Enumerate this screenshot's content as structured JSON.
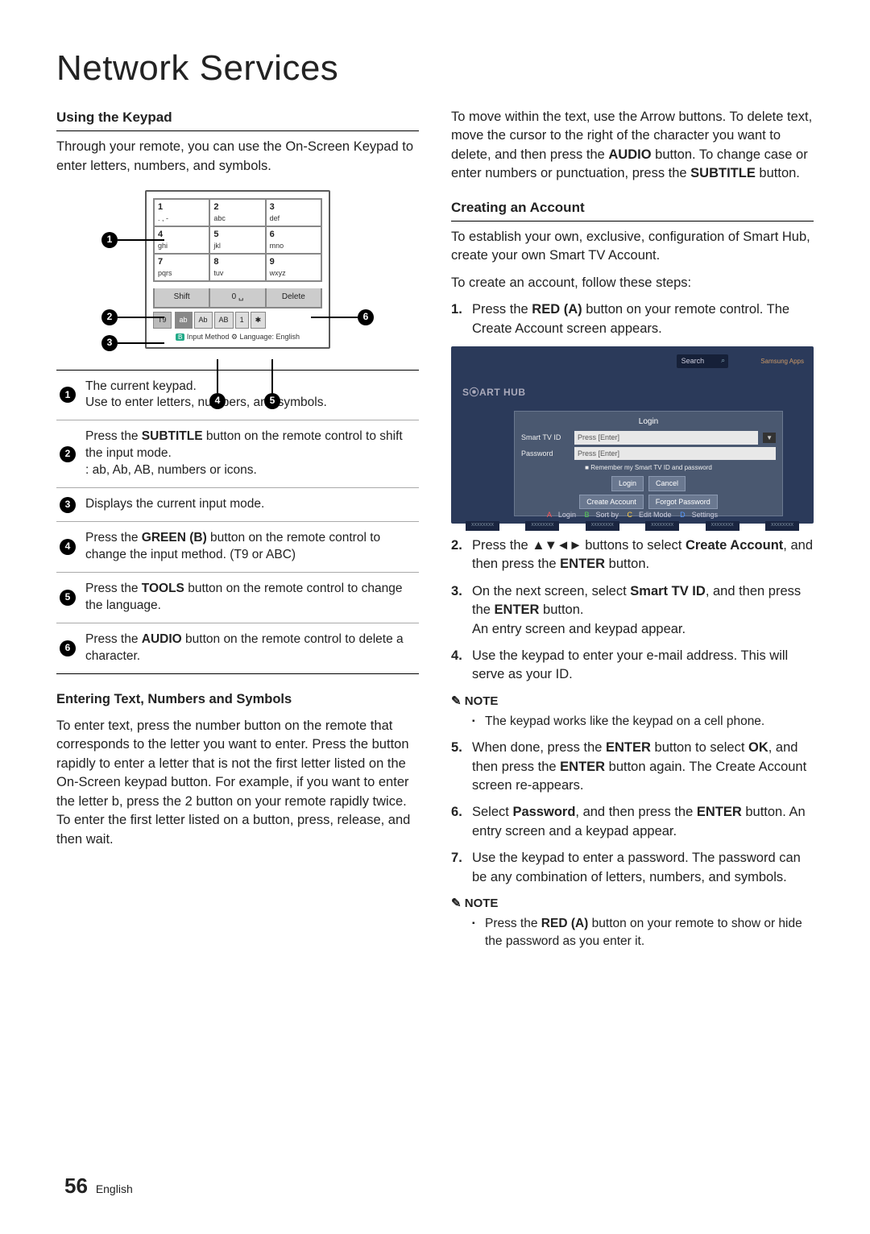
{
  "page_title": "Network Services",
  "left": {
    "heading1": "Using the Keypad",
    "intro1": "Through your remote, you can use the On-Screen Keypad to enter letters, numbers, and symbols.",
    "keypad": {
      "keys": [
        {
          "num": "1",
          "let": ". , -"
        },
        {
          "num": "2",
          "let": "abc"
        },
        {
          "num": "3",
          "let": "def"
        },
        {
          "num": "4",
          "let": "ghi"
        },
        {
          "num": "5",
          "let": "jkl"
        },
        {
          "num": "6",
          "let": "mno"
        },
        {
          "num": "7",
          "let": "pqrs"
        },
        {
          "num": "8",
          "let": "tuv"
        },
        {
          "num": "9",
          "let": "wxyz"
        }
      ],
      "row2": [
        "Shift",
        "0 ␣",
        "Delete"
      ],
      "modes_left": "T9",
      "modes": [
        "ab",
        "Ab",
        "AB",
        "1",
        "✱"
      ],
      "footer_prefix": "B",
      "footer_text": "Input Method   ⚙ Language: English"
    },
    "legend": [
      {
        "n": "1",
        "text": "The current keypad.\nUse to enter letters, numbers, and symbols."
      },
      {
        "n": "2",
        "text": "Press the SUBTITLE button on the remote control to shift the input mode.\n: ab, Ab, AB, numbers or icons.",
        "bold": "SUBTITLE"
      },
      {
        "n": "3",
        "text": "Displays the current input mode."
      },
      {
        "n": "4",
        "text": "Press the GREEN (B) button on the remote control to change the input method. (T9 or ABC)",
        "bold": "GREEN (B)"
      },
      {
        "n": "5",
        "text": "Press the TOOLS button on the remote control to change the language.",
        "bold": "TOOLS"
      },
      {
        "n": "6",
        "text": "Press the AUDIO button on the remote control to delete a character.",
        "bold": "AUDIO"
      }
    ],
    "heading2": "Entering Text, Numbers and Symbols",
    "para2": "To enter text, press the number button on the remote that corresponds to the letter you want to enter. Press the button rapidly to enter a letter that is not the first letter listed on the On-Screen keypad button. For example, if you want to enter the letter b, press the 2 button on your remote rapidly twice. To enter the first letter listed on a button, press, release, and then wait."
  },
  "right": {
    "move_text_pre": "To move within the text, use the Arrow buttons. To delete text, move the cursor to the right of the character you want to delete, and then press the ",
    "audio_btn": "AUDIO",
    "move_text_mid": " button. To change case or enter numbers or punctuation, press the ",
    "subtitle_btn": "SUBTITLE",
    "move_text_post": " button.",
    "heading1": "Creating an Account",
    "para1": "To establish your own, exclusive, configuration of Smart Hub, create your own Smart TV Account.",
    "para2": "To create an account, follow these steps:",
    "step1_pre": "Press the ",
    "step1_bold": "RED (A)",
    "step1_post": " button on your remote control. The Create Account screen appears.",
    "hub": {
      "logo": "S⦿ART HUB",
      "search": "Search",
      "apps_label": "Samsung Apps",
      "dialog_title": "Login",
      "field1_label": "Smart TV ID",
      "field1_value": "Press [Enter]",
      "field2_label": "Password",
      "field2_value": "Press [Enter]",
      "remember": "Remember my Smart TV ID and password",
      "btn_login": "Login",
      "btn_cancel": "Cancel",
      "btn_create": "Create Account",
      "btn_forgot": "Forgot Password",
      "footer_a": "Login",
      "footer_b": "Sort by",
      "footer_c": "Edit Mode",
      "footer_d": "Settings",
      "thumbs": [
        "xxxxxxxx",
        "xxxxxxxx",
        "xxxxxxxx",
        "xxxxxxxx",
        "xxxxxxxx",
        "xxxxxxxx"
      ]
    },
    "step2_pre": "Press the ",
    "step2_arrows": "▲▼◄►",
    "step2_mid": " buttons to select ",
    "step2_bold1": "Create Account",
    "step2_mid2": ", and then press the ",
    "step2_bold2": "ENTER",
    "step2_post": " button.",
    "step3_pre": "On the next screen, select ",
    "step3_bold1": "Smart TV ID",
    "step3_mid": ", and then press the ",
    "step3_bold2": "ENTER",
    "step3_post": " button.\nAn entry screen and keypad appear.",
    "step4": "Use the keypad to enter your e-mail address. This will serve as your ID.",
    "note_label": "NOTE",
    "note1_item": "The keypad works like the keypad on a cell phone.",
    "step5_pre": "When done, press the ",
    "step5_bold1": "ENTER",
    "step5_mid1": " button to select ",
    "step5_bold2": "OK",
    "step5_mid2": ", and then press the ",
    "step5_bold3": "ENTER",
    "step5_post": " button again. The Create Account screen re-appears.",
    "step6_pre": "Select ",
    "step6_bold1": "Password",
    "step6_mid": ", and then press the ",
    "step6_bold2": "ENTER",
    "step6_post": " button. An entry screen and a keypad appear.",
    "step7": "Use the keypad to enter a password. The password can be any combination of letters, numbers, and symbols.",
    "note2_item_pre": "Press the ",
    "note2_item_bold": "RED (A)",
    "note2_item_post": " button on your remote to show or hide the password as you enter it."
  },
  "footer": {
    "page_num": "56",
    "lang": "English"
  }
}
